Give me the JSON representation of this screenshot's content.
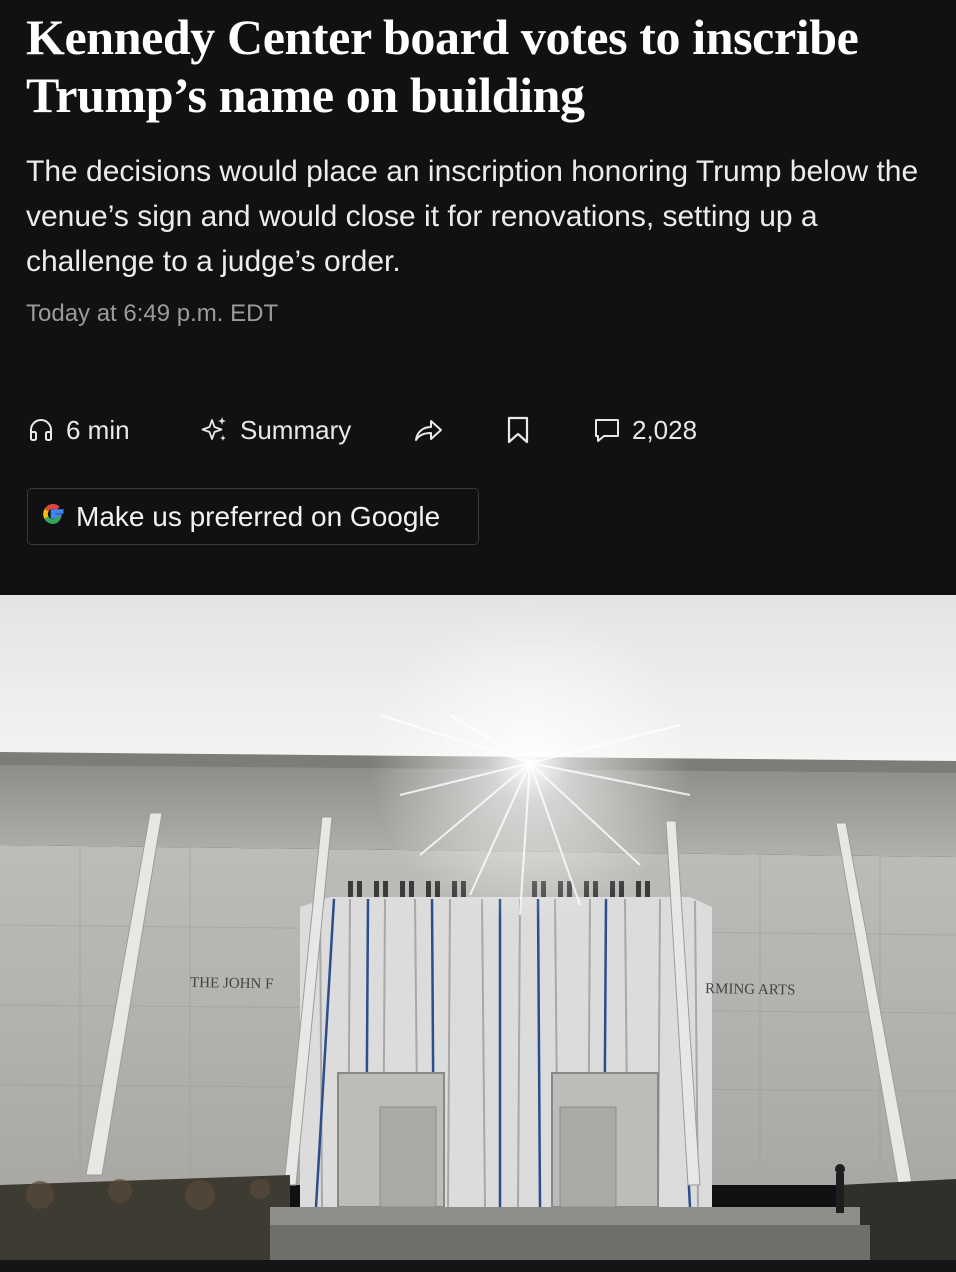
{
  "article": {
    "headline": "Kennedy Center board votes to inscribe Trump’s name on building",
    "dek": "The decisions would place an inscription honoring Trump below the venue’s sign and would close it for renovations, setting up a challenge to a judge’s order.",
    "timestamp": "Today at 6:49 p.m. EDT"
  },
  "toolbar": {
    "listen_label": "6 min",
    "summary_label": "Summary",
    "share_icon": "share-arrow-icon",
    "bookmark_icon": "bookmark-icon",
    "comments_count": "2,028"
  },
  "google_button": {
    "label": "Make us preferred on Google"
  },
  "photo": {
    "sign_left": "THE JOHN F",
    "sign_right": "RMING ARTS"
  },
  "colors": {
    "background": "#111113",
    "headline": "#ffffff",
    "dek": "#ececec",
    "timestamp": "#9b9b9b"
  }
}
